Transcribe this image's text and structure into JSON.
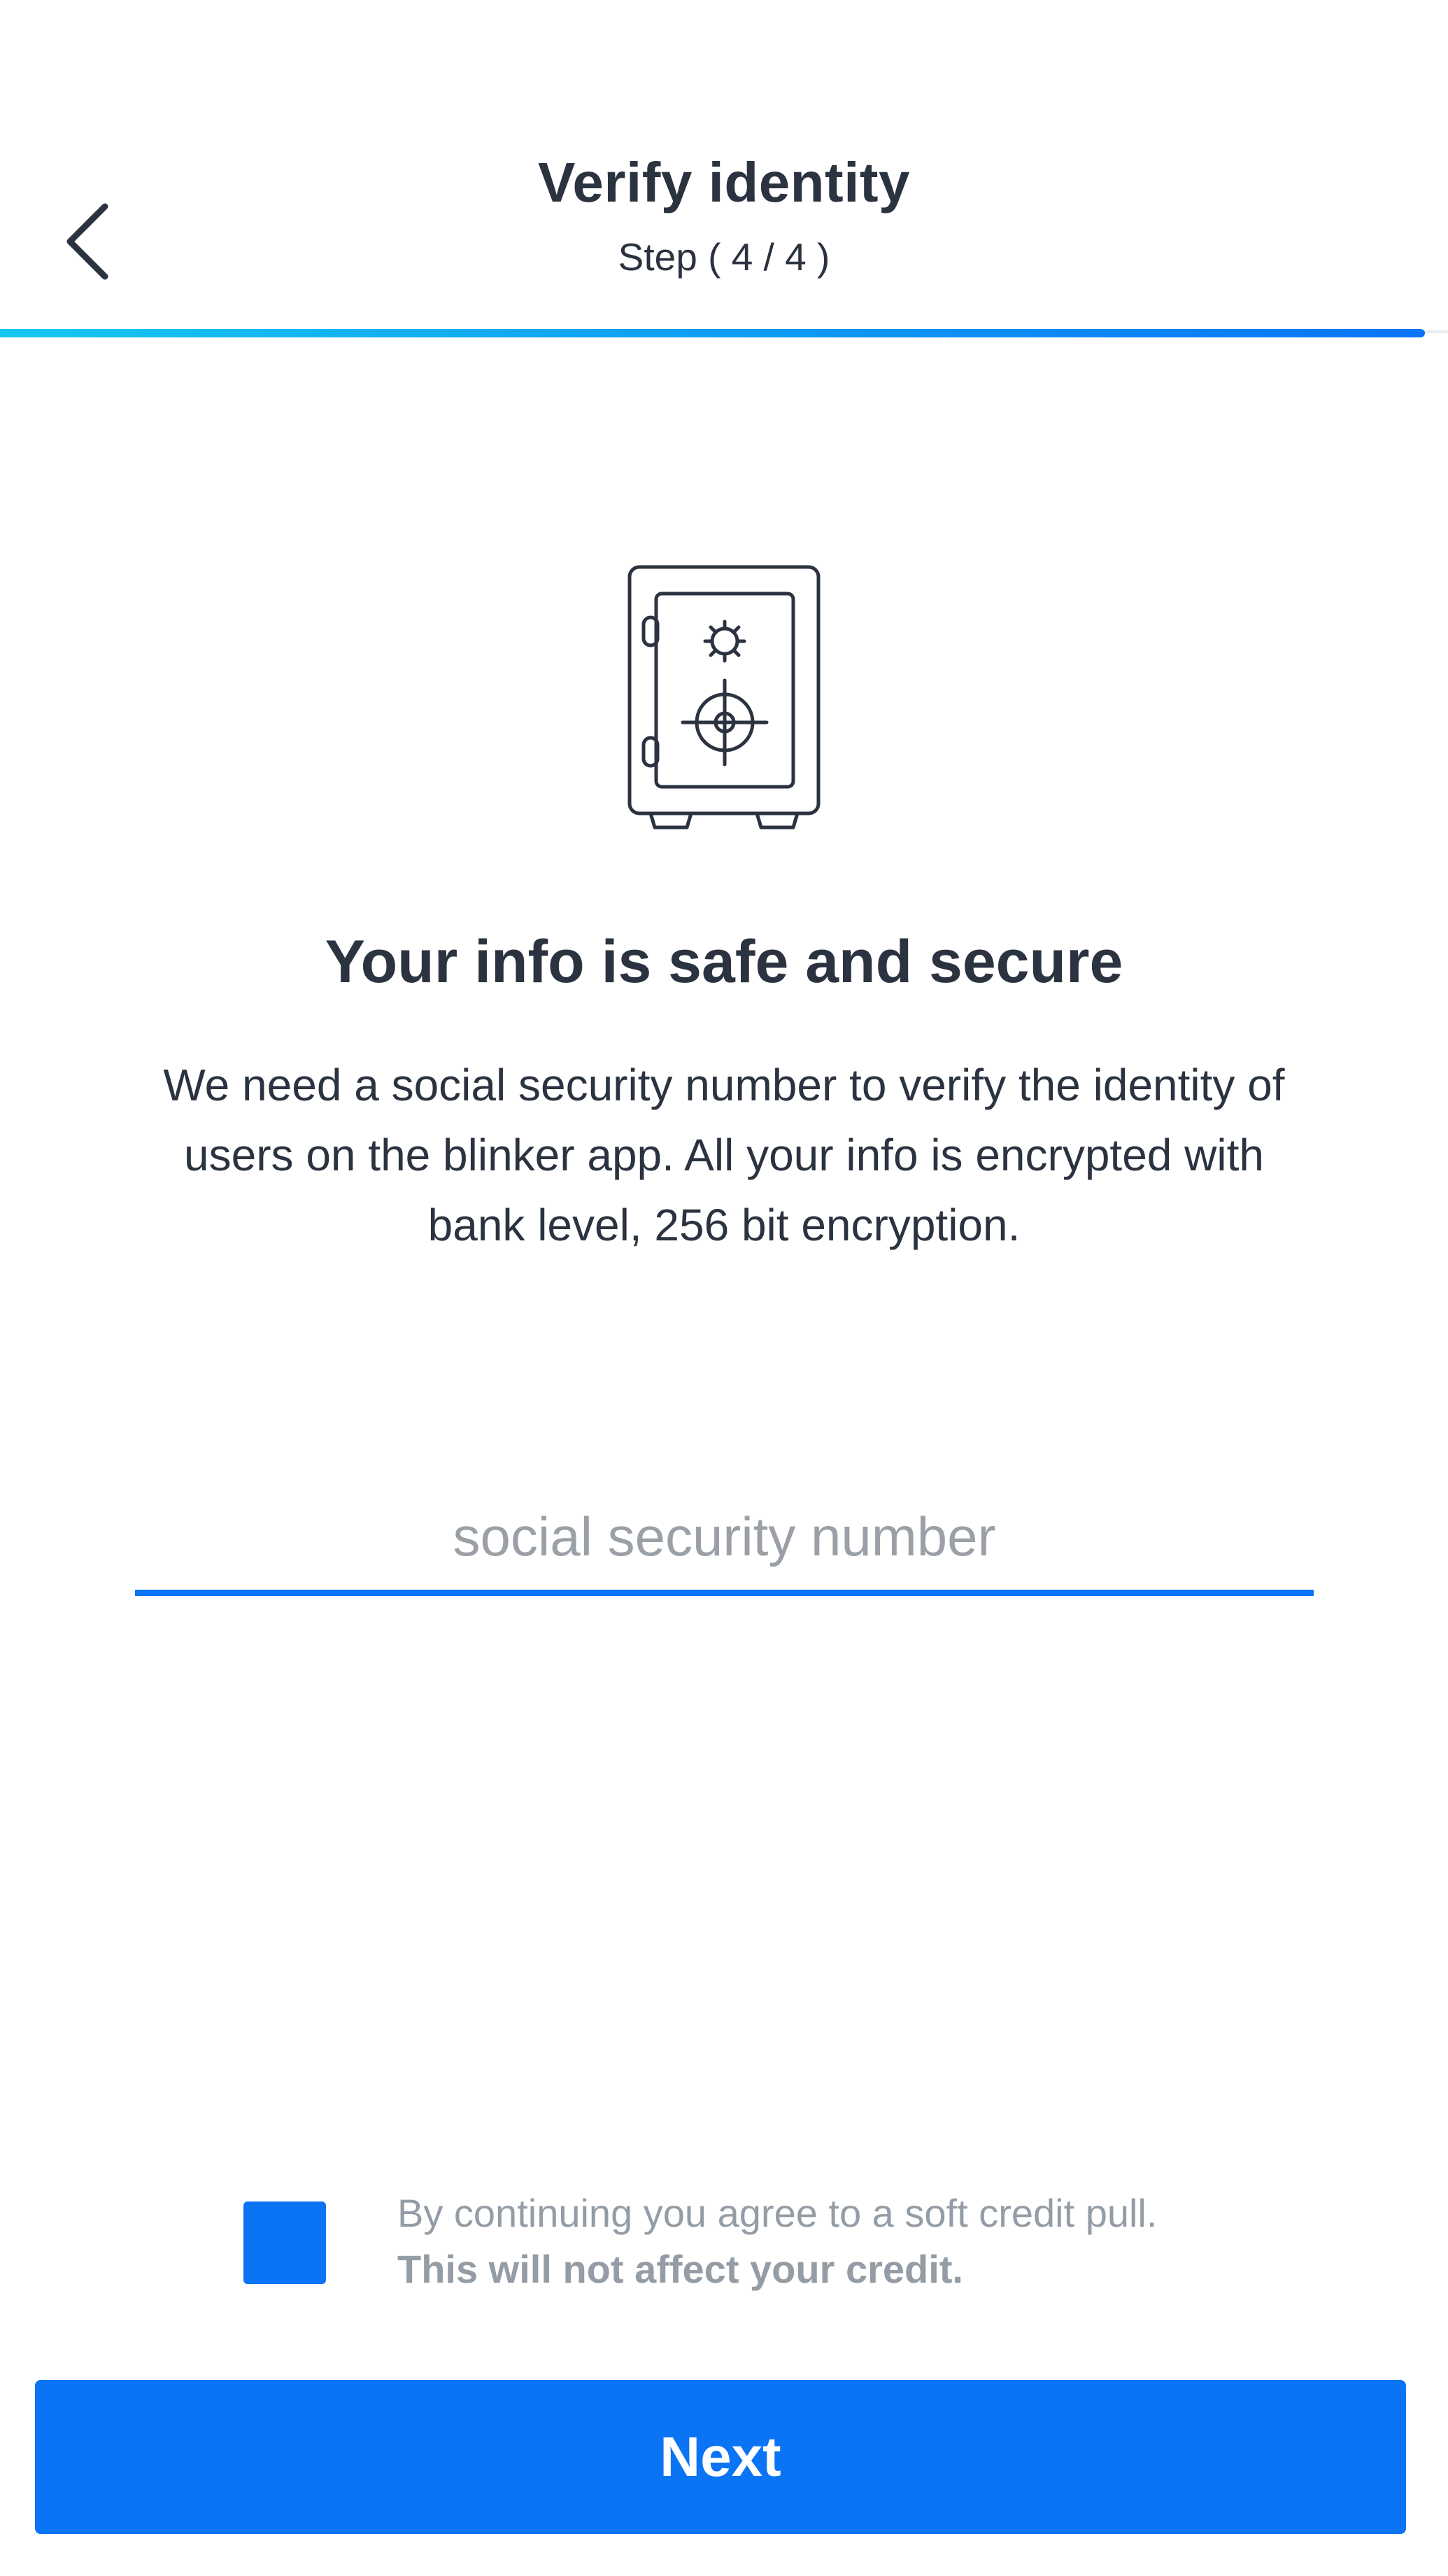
{
  "header": {
    "title": "Verify identity",
    "step": "Step ( 4 / 4 )",
    "back_icon": "chevron-left-icon"
  },
  "progress": {
    "fraction": 0.984,
    "track_color": "#e8ecf0",
    "gradient_start": "#16c7f2",
    "gradient_end": "#0a74f5"
  },
  "illustration": {
    "icon": "safe-icon"
  },
  "main": {
    "headline": "Your info is safe and secure",
    "description": "We need a social security number to verify the identity of users on the blinker app. All your info is encrypted with bank level, 256 bit encryption."
  },
  "ssn_input": {
    "placeholder": "social security number",
    "value": ""
  },
  "consent": {
    "checked": true,
    "text_regular": "By continuing you agree to a soft credit pull. ",
    "text_bold": "This will not affect your credit."
  },
  "footer": {
    "next_label": "Next"
  },
  "colors": {
    "accent": "#0a74f5",
    "text": "#2b3340",
    "muted": "#949ca6"
  }
}
